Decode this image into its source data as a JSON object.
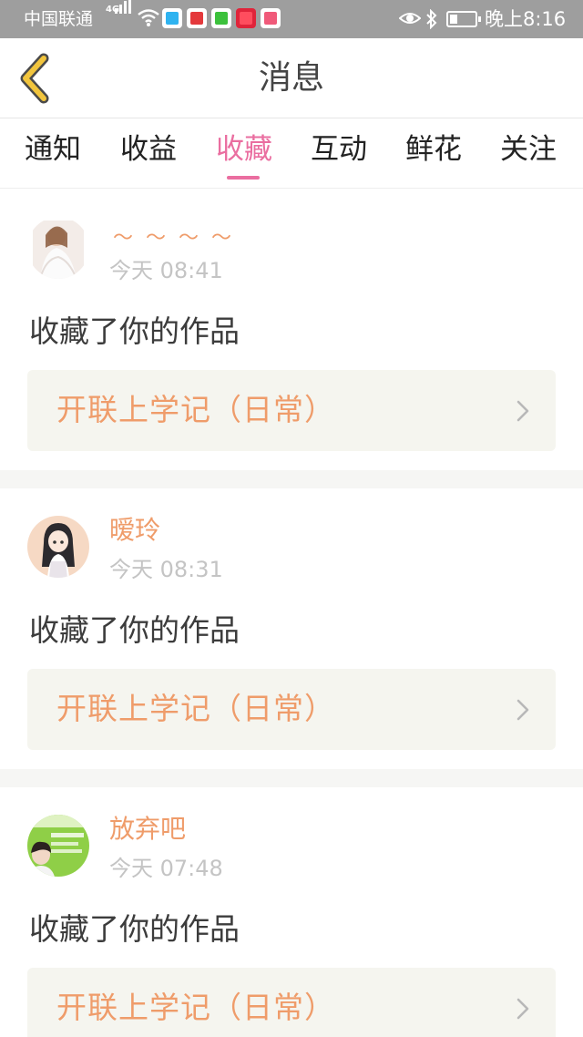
{
  "status_bar": {
    "carrier": "中国联通",
    "network": "4G",
    "time": "晚上8:16",
    "icons": [
      "signal-icon",
      "wifi-icon",
      "tencent-video-icon",
      "sina-icon",
      "iqiyi-icon",
      "xiaohongshu-icon",
      "youku-icon",
      "eye-icon",
      "bluetooth-icon",
      "battery-icon"
    ],
    "battery_level": 0.2
  },
  "header": {
    "title": "消息",
    "back_icon": "chevron-left-icon"
  },
  "tabs": [
    {
      "label": "通知",
      "active": false
    },
    {
      "label": "收益",
      "active": false
    },
    {
      "label": "收藏",
      "active": true
    },
    {
      "label": "互动",
      "active": false
    },
    {
      "label": "鲜花",
      "active": false
    },
    {
      "label": "关注",
      "active": false
    }
  ],
  "messages": [
    {
      "username": "～～～～",
      "time": "今天 08:41",
      "action": "收藏了你的作品",
      "work_title": "开联上学记（日常）"
    },
    {
      "username": "暧玲",
      "time": "今天 08:31",
      "action": "收藏了你的作品",
      "work_title": "开联上学记（日常）"
    },
    {
      "username": "放弃吧",
      "time": "今天 07:48",
      "action": "收藏了你的作品",
      "work_title": "开联上学记（日常）"
    }
  ],
  "colors": {
    "accent_pink": "#ea6ea0",
    "username_orange": "#ef9c6a",
    "back_yellow": "#f2c53d"
  }
}
